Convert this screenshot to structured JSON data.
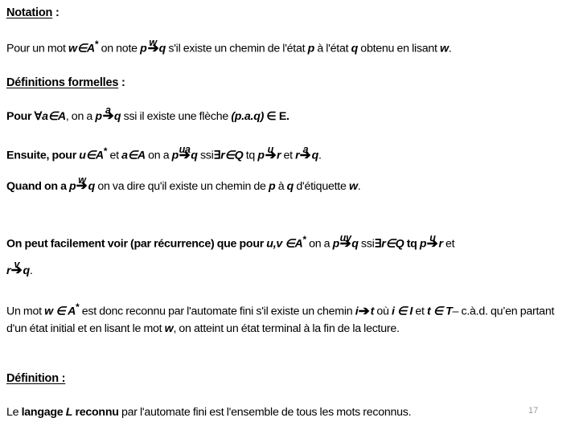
{
  "slide": {
    "page_number": "17",
    "background_color": "#ffffff",
    "text_color": "#000000",
    "page_number_color": "#9a9a9a",
    "arrow_glyph": "➔"
  },
  "headings": {
    "notation": "Notation",
    "notation_colon": " :",
    "definitions_formelles": "Définitions formelles",
    "definitions_formelles_colon": " :",
    "definition": "Définition :"
  },
  "paragraphs": {
    "pour_un_mot": {
      "seg1": "Pour un mot ",
      "w": "w",
      "in_a": "∈A",
      "star": "*",
      "seg2": " on note ",
      "p": "p",
      "arrow_label": "w",
      "q": "q",
      "seg3": " s'il existe un chemin de l'état ",
      "p2": "p",
      "seg4": " à l'état ",
      "q2": "q",
      "seg5": " obtenu en lisant ",
      "w2": "w",
      "seg6": "."
    },
    "pour_forall": {
      "seg1": "Pour ∀",
      "a": "a",
      "in_a": "∈A",
      "seg2": ", on a ",
      "p": "p",
      "arrow_label": "a",
      "q": "q",
      "seg3": " ssi il existe une flèche ",
      "arc": "(p.a.q)",
      "seg4": " ∈ E."
    },
    "ensuite": {
      "seg1": "Ensuite, pour ",
      "u": "u",
      "in_a1": "∈A",
      "star": "*",
      "seg2": " et ",
      "a": "a",
      "in_a2": "∈A",
      "seg3": " on a ",
      "p": "p",
      "arrow1_label": "ua",
      "q": "q",
      "seg4": " ssi",
      "exists": "∃",
      "r": "r",
      "in_q": "∈Q",
      "seg5": " tq ",
      "p2": "p",
      "arrow2_label": "u",
      "r2": "r",
      "seg6": " et ",
      "r3": "r",
      "arrow3_label": "a",
      "q2": "q",
      "seg7": "."
    },
    "quand": {
      "seg1": "Quand on a ",
      "p": "p",
      "arrow_label": "w",
      "q": "q",
      "seg2": " on va dire qu'il existe un chemin de ",
      "p2": "p",
      "seg3": " à ",
      "q2": "q",
      "seg4": " d'étiquette ",
      "w": "w",
      "seg5": "."
    },
    "on_peut": {
      "seg1": "On peut facilement voir (par récurrence) que pour ",
      "uv": "u,v",
      "in_a": " ∈A",
      "star": "*",
      "seg2": " on a ",
      "p": "p",
      "arrow1_label": "uv",
      "q": "q",
      "seg3": " ssi",
      "exists": "∃",
      "r": "r",
      "in_q": "∈Q",
      "seg4": " tq ",
      "p2": "p",
      "arrow2_label": "u",
      "r2": "r",
      "seg5": " et"
    },
    "r_arrow_q": {
      "r": "r",
      "arrow_label": "v",
      "q": "q",
      "seg1": "."
    },
    "un_mot": {
      "seg1": "Un mot ",
      "w": "w",
      "in_a": " ∈ A",
      "star": "*",
      "seg2": " est donc reconnu par l'automate fini s'il existe un chemin ",
      "i": "i",
      "arrow_label": "",
      "t": "t",
      "seg3": " où ",
      "i2": "i",
      "in_i": " ∈ I",
      "seg4": " et ",
      "t2": "t",
      "in_t": " ∈ T",
      "dash": "– ",
      "seg5": "c.à.d. qu’en partant d'un état initial et en lisant le mot ",
      "w2": "w",
      "seg6": ", on atteint un état terminal à la fin de la lecture."
    },
    "le_langage": {
      "seg1": "Le ",
      "bold1": "langage ",
      "l": "L",
      "bold2": " reconnu",
      "seg2": " par l'automate fini est l'ensemble de tous les mots reconnus."
    }
  }
}
